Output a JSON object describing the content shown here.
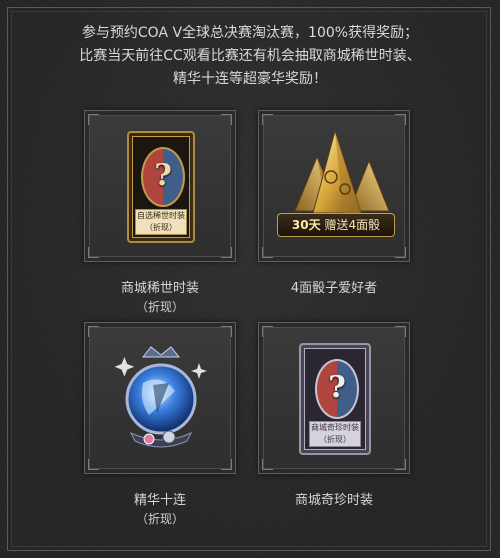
{
  "intro": {
    "line1": "参与预约COA V全球总决赛淘汰赛，100%获得奖励；",
    "line2": "比赛当天前往CC观看比赛还有机会抽取商城稀世时装、",
    "line3": "精华十连等超豪华奖励！"
  },
  "rewards": [
    {
      "name": "商城稀世时装",
      "note": "（折现）",
      "plate_line1": "自选稀世时装",
      "plate_line2": "（折现）",
      "icon": "gold-costume-card-icon"
    },
    {
      "name": "4面骰子爱好者",
      "note": "",
      "ribbon_part1": "30天",
      "ribbon_part2": "赠送4面骰",
      "icon": "golden-dice-icon"
    },
    {
      "name": "精华十连",
      "note": "（折现）",
      "icon": "essence-orb-icon"
    },
    {
      "name": "商城奇珍时装",
      "note": "（折现）",
      "plate_line1": "商城奇珍时装",
      "plate_line2": "（折现）",
      "icon": "silver-costume-card-icon"
    }
  ],
  "colors": {
    "background": "#262626",
    "gold": "#c79c48",
    "silver": "#b3aec0"
  }
}
